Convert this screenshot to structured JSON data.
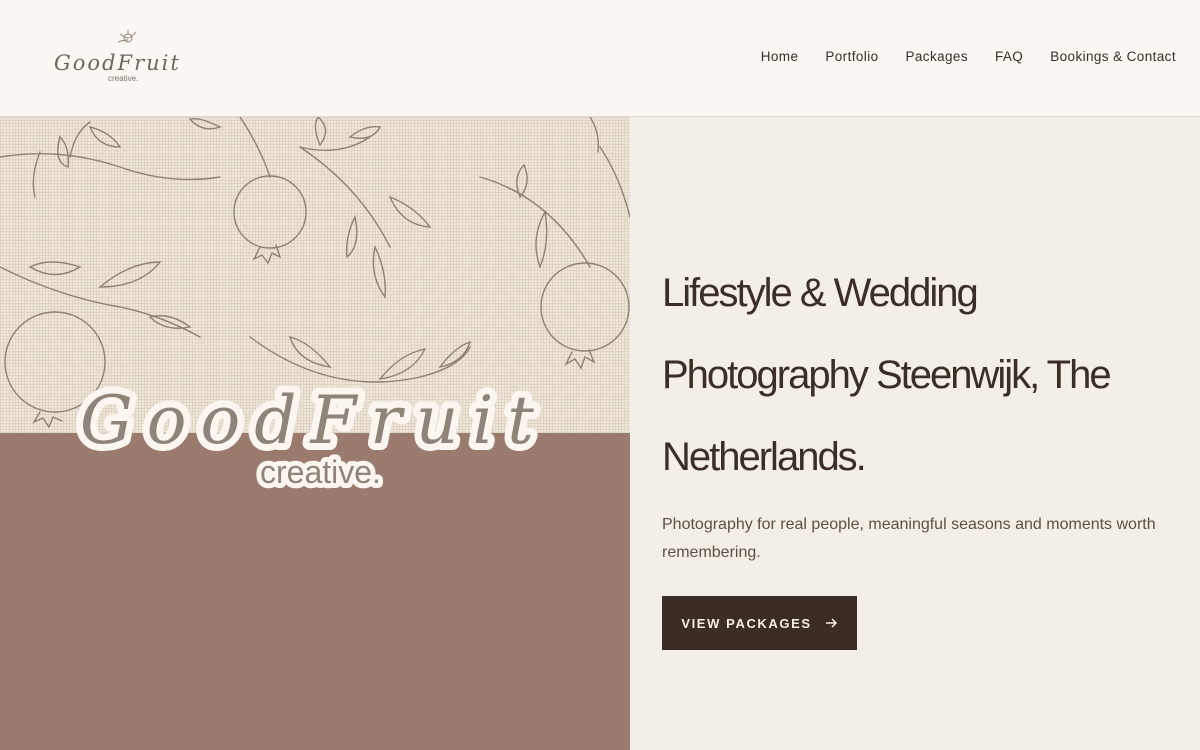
{
  "brand": {
    "name_script": "GoodFruit",
    "name_sub": "creative."
  },
  "nav": {
    "items": [
      {
        "label": "Home"
      },
      {
        "label": "Portfolio"
      },
      {
        "label": "Packages"
      },
      {
        "label": "FAQ"
      },
      {
        "label": "Bookings & Contact"
      }
    ]
  },
  "hero": {
    "headline_line1": "Lifestyle & Wedding",
    "headline_line2": "Photography Steenwijk, The",
    "headline_line3": "Netherlands.",
    "subtext": "Photography for real people, meaningful seasons and moments worth remembering.",
    "cta_label": "VIEW PACKAGES",
    "cta_icon": "arrow-right-icon"
  },
  "colors": {
    "background": "#fbf8f3",
    "hero_right_bg": "#f3eee6",
    "mauve": "#9b7b6e",
    "dark_brown": "#3b2d25",
    "pattern_bg": "#efe6da"
  }
}
